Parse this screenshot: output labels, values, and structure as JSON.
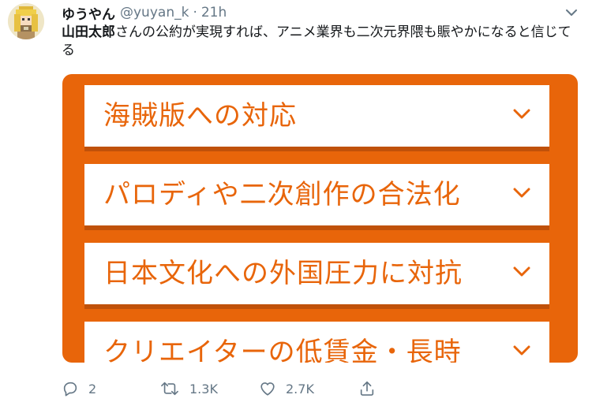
{
  "tweet": {
    "display_name": "ゆうやん",
    "handle": "@yuyan_k",
    "separator": "·",
    "time": "21h",
    "text_bold": "山田太郎",
    "text_rest": "さんの公約が実現すれば、アニメ業界も二次元界隈も賑やかになると信じてる"
  },
  "card": {
    "accent_color": "#e8650a",
    "items": [
      {
        "label": "海賊版への対応",
        "icon": "chevron-down-icon"
      },
      {
        "label": "パロディや二次創作の合法化",
        "icon": "chevron-down-icon"
      },
      {
        "label": "日本文化への外国圧力に対抗",
        "icon": "chevron-down-icon"
      },
      {
        "label": "クリエイターの低賃金・長時",
        "icon": "chevron-down-icon"
      }
    ]
  },
  "actions": {
    "reply_count": "2",
    "retweet_count": "1.3K",
    "like_count": "2.7K",
    "icons": [
      "reply-icon",
      "retweet-icon",
      "like-icon",
      "share-icon"
    ]
  },
  "colors": {
    "secondary_text": "#657786",
    "primary_text": "#14171a"
  }
}
